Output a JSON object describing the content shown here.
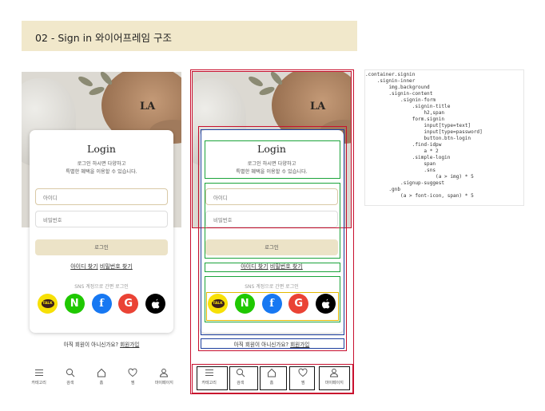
{
  "header": {
    "title": "02 - Sign in 와이어프레임 구조"
  },
  "photo": {
    "logo_mark": "LA"
  },
  "signin": {
    "title": "Login",
    "description_line1": "로그인 하시면 다양하고",
    "description_line2": "특별한 혜택을 이용할 수 있습니다.",
    "id_placeholder": "아이디",
    "pw_placeholder": "비밀번호",
    "login_button": "로그인",
    "find_id": "아이디 찾기",
    "find_pw": "비밀번호 찾기",
    "simple_login_title": "SNS 계정으로 간편 로그인",
    "sns": [
      {
        "name": "kakao",
        "icon": "kakao-talk-icon",
        "label": "TALK",
        "color": "#f7e007"
      },
      {
        "name": "naver",
        "icon": "naver-icon",
        "label": "N",
        "color": "#1fc800"
      },
      {
        "name": "facebook",
        "icon": "facebook-icon",
        "label": "f",
        "color": "#1778f2"
      },
      {
        "name": "google",
        "icon": "google-icon",
        "label": "G",
        "color": "#ea4335"
      },
      {
        "name": "apple",
        "icon": "apple-icon",
        "color": "#000000"
      }
    ]
  },
  "signup": {
    "text": "아직 회원이 아니신가요?",
    "link": "회원가입"
  },
  "gnb": {
    "items": [
      {
        "label": "카테고리",
        "icon": "menu-icon"
      },
      {
        "label": "검색",
        "icon": "search-icon"
      },
      {
        "label": "홈",
        "icon": "home-icon"
      },
      {
        "label": "찜",
        "icon": "heart-icon"
      },
      {
        "label": "마이페이지",
        "icon": "user-icon"
      }
    ]
  },
  "overlay_colors": {
    "container": "#c8102e",
    "content": "#1e3f9e",
    "block": "#1aa33a",
    "sns": "#e3b800",
    "gnb": "#111111"
  },
  "code": {
    "lines": [
      ".container.signin",
      "    .signin-inner",
      "        img.background",
      "        .signin-content",
      "            .signin-form",
      "                .signin-title",
      "                    h2,span",
      "                form.signin",
      "                    input[type=text]",
      "                    input[type=password]",
      "                    button.btn-login",
      "                .find-idpw",
      "                    a * 2",
      "                .simple-login",
      "                    span",
      "                    .sns",
      "                        (a > img) * 5",
      "            .signup-suggest",
      "        .gnb",
      "            (a > font-icon, span) * 5"
    ]
  }
}
